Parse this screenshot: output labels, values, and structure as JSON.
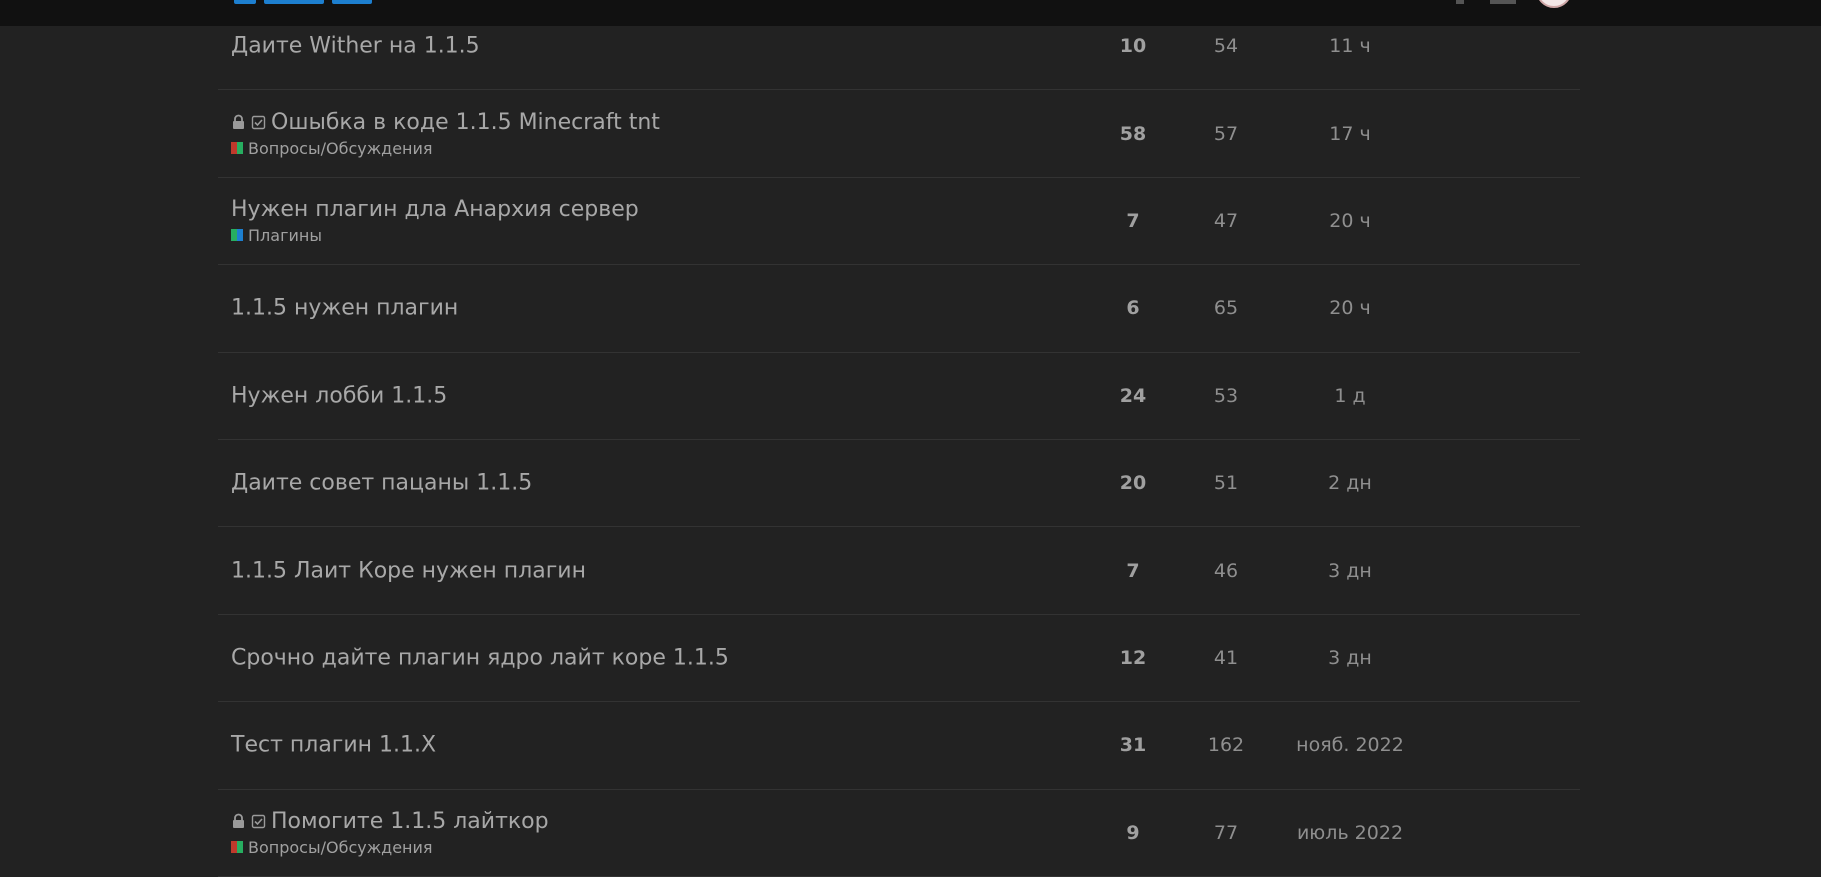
{
  "colors": {
    "background": "#222222",
    "header": "#111111",
    "brand_blue": "#1d7fcf",
    "divider": "#333333",
    "cat_discussion": [
      "#c0392b",
      "#27ae60"
    ],
    "cat_plugins": [
      "#27ae60",
      "#1d7fcf"
    ]
  },
  "topics": [
    {
      "title": "Даите Wither на 1.1.5",
      "category": "",
      "category_icon": "",
      "closed": false,
      "replies": "10",
      "views": "54",
      "activity": "11 ч"
    },
    {
      "title": "Ошыбка в коде 1.1.5 Minecraft tnt",
      "category": "Вопросы/Обсуждения",
      "category_icon": "discussion",
      "closed": true,
      "replies": "58",
      "views": "57",
      "activity": "17 ч"
    },
    {
      "title": "Нужен плагин дла Анархия сервер",
      "category": "Плагины",
      "category_icon": "plugins",
      "closed": false,
      "replies": "7",
      "views": "47",
      "activity": "20 ч"
    },
    {
      "title": "1.1.5 нужен плагин",
      "category": "",
      "category_icon": "",
      "closed": false,
      "replies": "6",
      "views": "65",
      "activity": "20 ч"
    },
    {
      "title": "Нужен лобби 1.1.5",
      "category": "",
      "category_icon": "",
      "closed": false,
      "replies": "24",
      "views": "53",
      "activity": "1 д"
    },
    {
      "title": "Даите совет пацаны 1.1.5",
      "category": "",
      "category_icon": "",
      "closed": false,
      "replies": "20",
      "views": "51",
      "activity": "2 дн"
    },
    {
      "title": "1.1.5 Лаит Коре нужен плагин",
      "category": "",
      "category_icon": "",
      "closed": false,
      "replies": "7",
      "views": "46",
      "activity": "3 дн"
    },
    {
      "title": "Срочно дайте плагин ядро лайт коре 1.1.5",
      "category": "",
      "category_icon": "",
      "closed": false,
      "replies": "12",
      "views": "41",
      "activity": "3 дн"
    },
    {
      "title": "Тест плагин 1.1.X",
      "category": "",
      "category_icon": "",
      "closed": false,
      "replies": "31",
      "views": "162",
      "activity": "нояб. 2022"
    },
    {
      "title": "Помогите 1.1.5 лайткор",
      "category": "Вопросы/Обсуждения",
      "category_icon": "discussion",
      "closed": true,
      "replies": "9",
      "views": "77",
      "activity": "июль 2022"
    }
  ]
}
